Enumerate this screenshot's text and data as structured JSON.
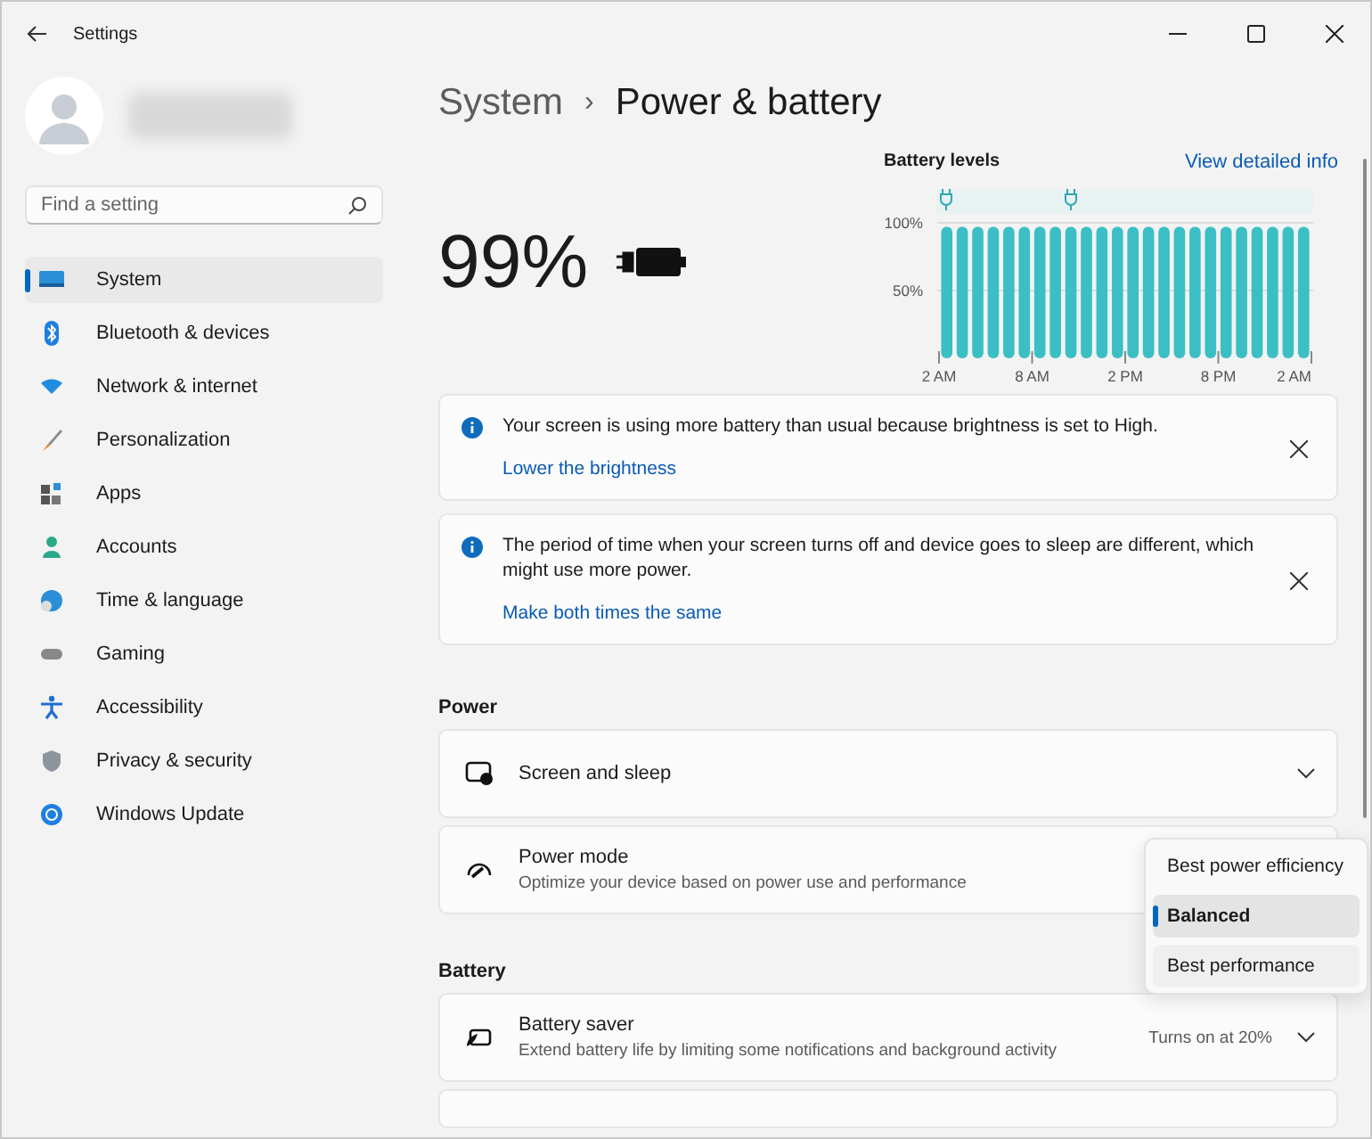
{
  "window": {
    "title": "Settings"
  },
  "search": {
    "placeholder": "Find a setting"
  },
  "sidebar": {
    "items": [
      {
        "label": "System",
        "selected": true
      },
      {
        "label": "Bluetooth & devices",
        "selected": false
      },
      {
        "label": "Network & internet",
        "selected": false
      },
      {
        "label": "Personalization",
        "selected": false
      },
      {
        "label": "Apps",
        "selected": false
      },
      {
        "label": "Accounts",
        "selected": false
      },
      {
        "label": "Time & language",
        "selected": false
      },
      {
        "label": "Gaming",
        "selected": false
      },
      {
        "label": "Accessibility",
        "selected": false
      },
      {
        "label": "Privacy & security",
        "selected": false
      },
      {
        "label": "Windows Update",
        "selected": false
      }
    ]
  },
  "breadcrumb": {
    "parent": "System",
    "separator": "›",
    "current": "Power & battery"
  },
  "battery": {
    "percent": "99%"
  },
  "battery_levels": {
    "title": "Battery levels",
    "link": "View detailed info",
    "time_labels": [
      "2 AM",
      "8 AM",
      "2 PM",
      "8 PM",
      "2 AM"
    ],
    "chart_data": {
      "type": "bar",
      "ylim": [
        0,
        100
      ],
      "yticks": [
        {
          "value": 50,
          "label": "50%"
        },
        {
          "value": 100,
          "label": "100%"
        }
      ],
      "values": [
        97,
        97,
        97,
        97,
        97,
        97,
        97,
        97,
        97,
        97,
        97,
        97,
        97,
        97,
        97,
        97,
        97,
        97,
        97,
        97,
        97,
        97,
        97,
        97
      ]
    }
  },
  "notices": [
    {
      "text": "Your screen is using more battery than usual because brightness is set to High.",
      "link": "Lower the brightness"
    },
    {
      "text": "The period of time when your screen turns off and device goes to sleep are different, which might use more power.",
      "link": "Make both times the same"
    }
  ],
  "sections": [
    {
      "title": "Power",
      "rows": [
        {
          "title": "Screen and sleep"
        },
        {
          "title": "Power mode",
          "subtitle": "Optimize your device based on power use and performance"
        }
      ]
    },
    {
      "title": "Battery",
      "rows": [
        {
          "title": "Battery saver",
          "subtitle": "Extend battery life by limiting some notifications and background activity",
          "value": "Turns on at 20%"
        }
      ]
    }
  ],
  "power_mode_menu": {
    "options": [
      {
        "label": "Best power efficiency",
        "selected": false
      },
      {
        "label": "Balanced",
        "selected": true
      },
      {
        "label": "Best performance",
        "selected": false
      }
    ]
  }
}
